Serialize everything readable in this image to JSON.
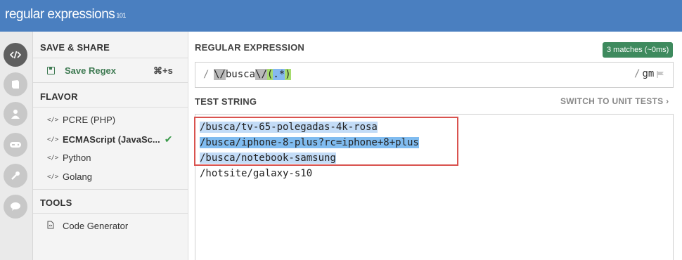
{
  "header": {
    "logo_text": "regular expressions",
    "logo_sup": "101"
  },
  "icons": [
    "code-icon",
    "library-icon",
    "user-icon",
    "gamepad-icon",
    "wrench-icon",
    "chat-icon"
  ],
  "sidebar": {
    "save_share": {
      "title": "SAVE & SHARE",
      "save_label": "Save Regex",
      "shortcut": "⌘+s"
    },
    "flavor": {
      "title": "FLAVOR",
      "items": [
        {
          "tag": "</>",
          "label": "PCRE (PHP)"
        },
        {
          "tag": "</>",
          "label": "ECMAScript (JavaSc...",
          "selected": true
        },
        {
          "tag": "</>",
          "label": "Python"
        },
        {
          "tag": "</>",
          "label": "Golang"
        }
      ]
    },
    "tools": {
      "title": "TOOLS",
      "items": [
        {
          "label": "Code Generator"
        }
      ]
    }
  },
  "regex": {
    "title": "REGULAR EXPRESSION",
    "match_badge": "3 matches (~0ms)",
    "open_delim": "/",
    "parts": {
      "esc1": "\\/",
      "lit": "busca",
      "esc2": "\\/",
      "open": "(",
      "dot": ".*",
      "close": ")"
    },
    "close_delim": "/",
    "flags": "gm"
  },
  "test": {
    "title": "TEST STRING",
    "switch_label": "SWITCH TO UNIT TESTS ›",
    "lines": [
      "/busca/tv-65-polegadas-4k-rosa",
      "/busca/iphone-8-plus?rc=iphone+8+plus",
      "/busca/notebook-samsung",
      "/hotsite/galaxy-s10"
    ]
  },
  "colors": {
    "header": "#4a7fc0",
    "badge": "#3e8a5e",
    "highlight_box": "#d9534f"
  }
}
